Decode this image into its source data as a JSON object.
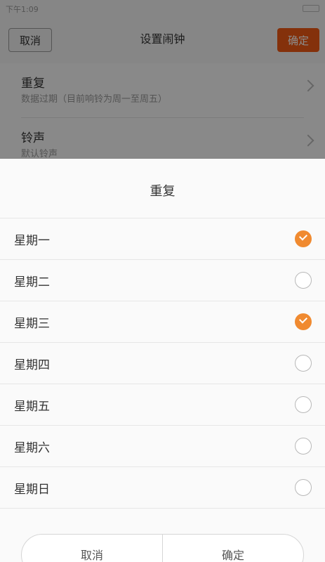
{
  "status_bar": {
    "time": "下午1:09"
  },
  "header": {
    "cancel_label": "取消",
    "title": "设置闹钟",
    "confirm_label": "确定"
  },
  "settings": [
    {
      "title": "重复",
      "subtitle": "数据过期（目前响铃为周一至周五）"
    },
    {
      "title": "铃声",
      "subtitle": "默认铃声"
    }
  ],
  "sheet": {
    "title": "重复",
    "days": [
      {
        "label": "星期一",
        "checked": true
      },
      {
        "label": "星期二",
        "checked": false
      },
      {
        "label": "星期三",
        "checked": true
      },
      {
        "label": "星期四",
        "checked": false
      },
      {
        "label": "星期五",
        "checked": false
      },
      {
        "label": "星期六",
        "checked": false
      },
      {
        "label": "星期日",
        "checked": false
      }
    ],
    "cancel_label": "取消",
    "confirm_label": "确定"
  },
  "colors": {
    "accent": "#f05a14",
    "check": "#f08a30"
  }
}
